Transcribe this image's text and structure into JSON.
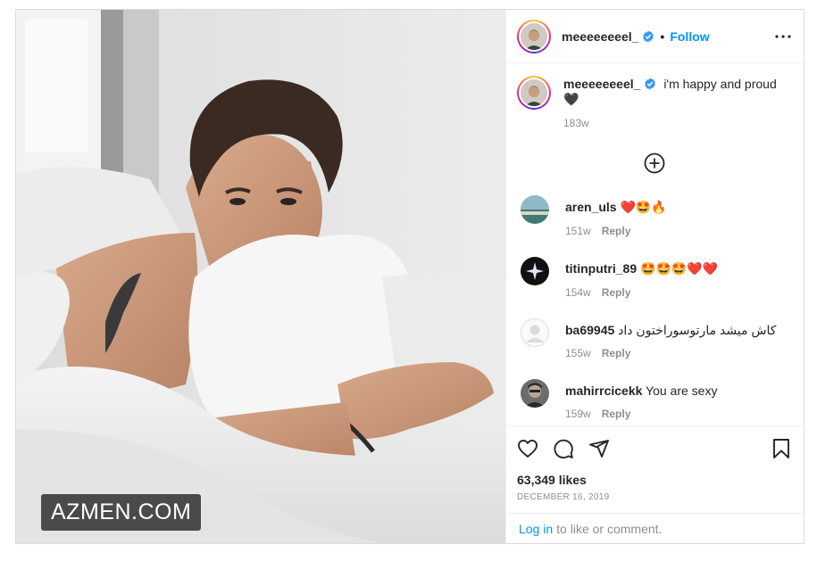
{
  "post": {
    "username": "meeeeeeeel_",
    "follow_label": "Follow",
    "separator": "•",
    "watermark": "AZMEN.COM"
  },
  "caption": {
    "username": "meeeeeeeel_",
    "text": "i'm happy and proud",
    "emoji": "🖤",
    "age": "183w"
  },
  "comments": [
    {
      "username": "aren_uls",
      "text": "❤️🤩🔥",
      "age": "151w",
      "reply": "Reply"
    },
    {
      "username": "titinputri_89",
      "text": "🤩🤩🤩❤️❤️",
      "age": "154w",
      "reply": "Reply"
    },
    {
      "username": "ba69945",
      "text": "کاش میشد مارتوسوراختون داد",
      "age": "155w",
      "reply": "Reply"
    },
    {
      "username": "mahirrcicekk",
      "text": "You are sexy",
      "age": "159w",
      "reply": "Reply"
    }
  ],
  "stats": {
    "likes": "63,349 likes",
    "date": "DECEMBER 16, 2019"
  },
  "footer": {
    "login_link": "Log in",
    "login_text": "to like or comment."
  },
  "icons": [
    "verified-badge-icon",
    "more-options-icon",
    "load-more-plus-icon",
    "heart-icon",
    "comment-icon",
    "share-icon",
    "bookmark-icon"
  ],
  "colors": {
    "accent": "#0095f6",
    "muted": "#8e8e8e",
    "text": "#262626",
    "border": "#dbdbdb"
  }
}
